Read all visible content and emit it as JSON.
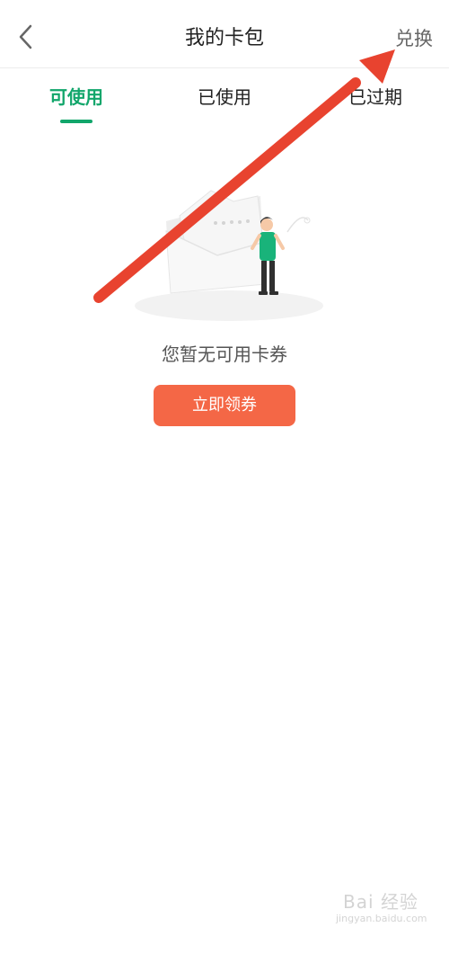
{
  "header": {
    "title": "我的卡包",
    "action": "兑换",
    "back_icon": "chevron-left-icon"
  },
  "tabs": [
    {
      "label": "可使用",
      "active": true
    },
    {
      "label": "已使用",
      "active": false
    },
    {
      "label": "已过期",
      "active": false
    }
  ],
  "empty_state": {
    "message": "您暂无可用卡券",
    "button": "立即领券"
  },
  "overlay": {
    "arrow_color": "#e8432f"
  },
  "colors": {
    "accent": "#12a66b",
    "button": "#f46746"
  },
  "watermark": {
    "logo": "Bai 经验",
    "subtitle": "jingyan.baidu.com"
  }
}
